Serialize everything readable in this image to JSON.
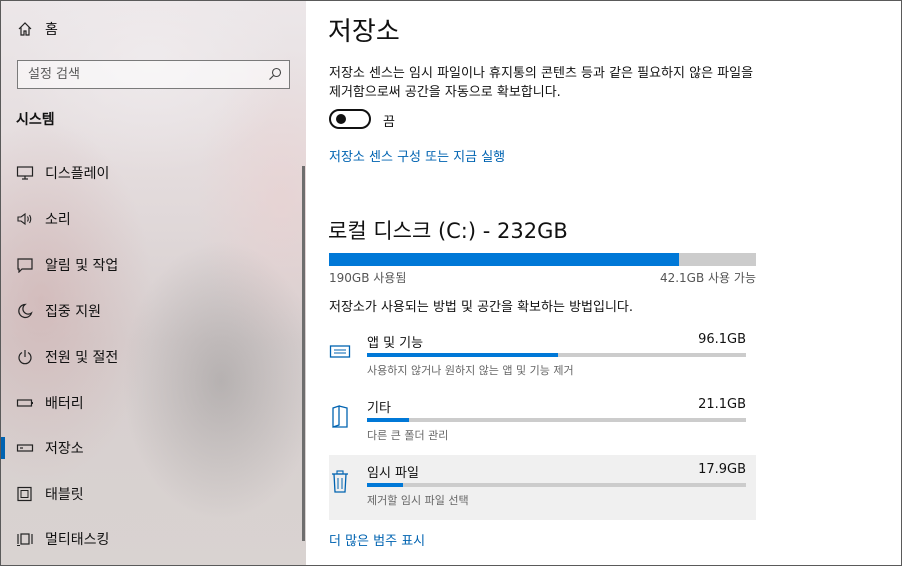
{
  "sidebar": {
    "home_label": "홈",
    "search_placeholder": "설정 검색",
    "section_title": "시스템",
    "items": [
      {
        "label": "디스플레이",
        "icon": "display-icon"
      },
      {
        "label": "소리",
        "icon": "speaker-icon"
      },
      {
        "label": "알림 및 작업",
        "icon": "notification-icon"
      },
      {
        "label": "집중 지원",
        "icon": "moon-icon"
      },
      {
        "label": "전원 및 절전",
        "icon": "power-icon"
      },
      {
        "label": "배터리",
        "icon": "battery-icon"
      },
      {
        "label": "저장소",
        "icon": "storage-icon",
        "active": true
      },
      {
        "label": "태블릿",
        "icon": "tablet-icon"
      },
      {
        "label": "멀티태스킹",
        "icon": "multitasking-icon"
      }
    ]
  },
  "main": {
    "title": "저장소",
    "description": "저장소 센스는 임시 파일이나 휴지통의 콘텐츠 등과 같은 필요하지 않은 파일을 제거함으로써 공간을 자동으로 확보합니다.",
    "toggle": {
      "state": "off",
      "label": "끔"
    },
    "configure_link": "저장소 센스 구성 또는 지금 실행",
    "disk": {
      "title": "로컬 디스크 (C:) - 232GB",
      "used_label": "190GB 사용됨",
      "free_label": "42.1GB 사용 가능",
      "used_fraction": 0.819
    },
    "how_text": "저장소가 사용되는 방법 및 공간을 확보하는 방법입니다.",
    "categories": [
      {
        "name": "앱 및 기능",
        "size": "96.1GB",
        "sub": "사용하지 않거나 원하지 않는 앱 및 기능 제거",
        "icon": "apps-icon",
        "fraction": 0.505
      },
      {
        "name": "기타",
        "size": "21.1GB",
        "sub": "다른 큰 폴더 관리",
        "icon": "other-icon",
        "fraction": 0.111
      },
      {
        "name": "임시 파일",
        "size": "17.9GB",
        "sub": "제거할 임시 파일 선택",
        "icon": "trash-icon",
        "fraction": 0.094
      }
    ],
    "more_link": "더 많은 범주 표시"
  },
  "colors": {
    "accent": "#0078d7",
    "link": "#0063b1",
    "bar_bg": "#cccccc"
  }
}
